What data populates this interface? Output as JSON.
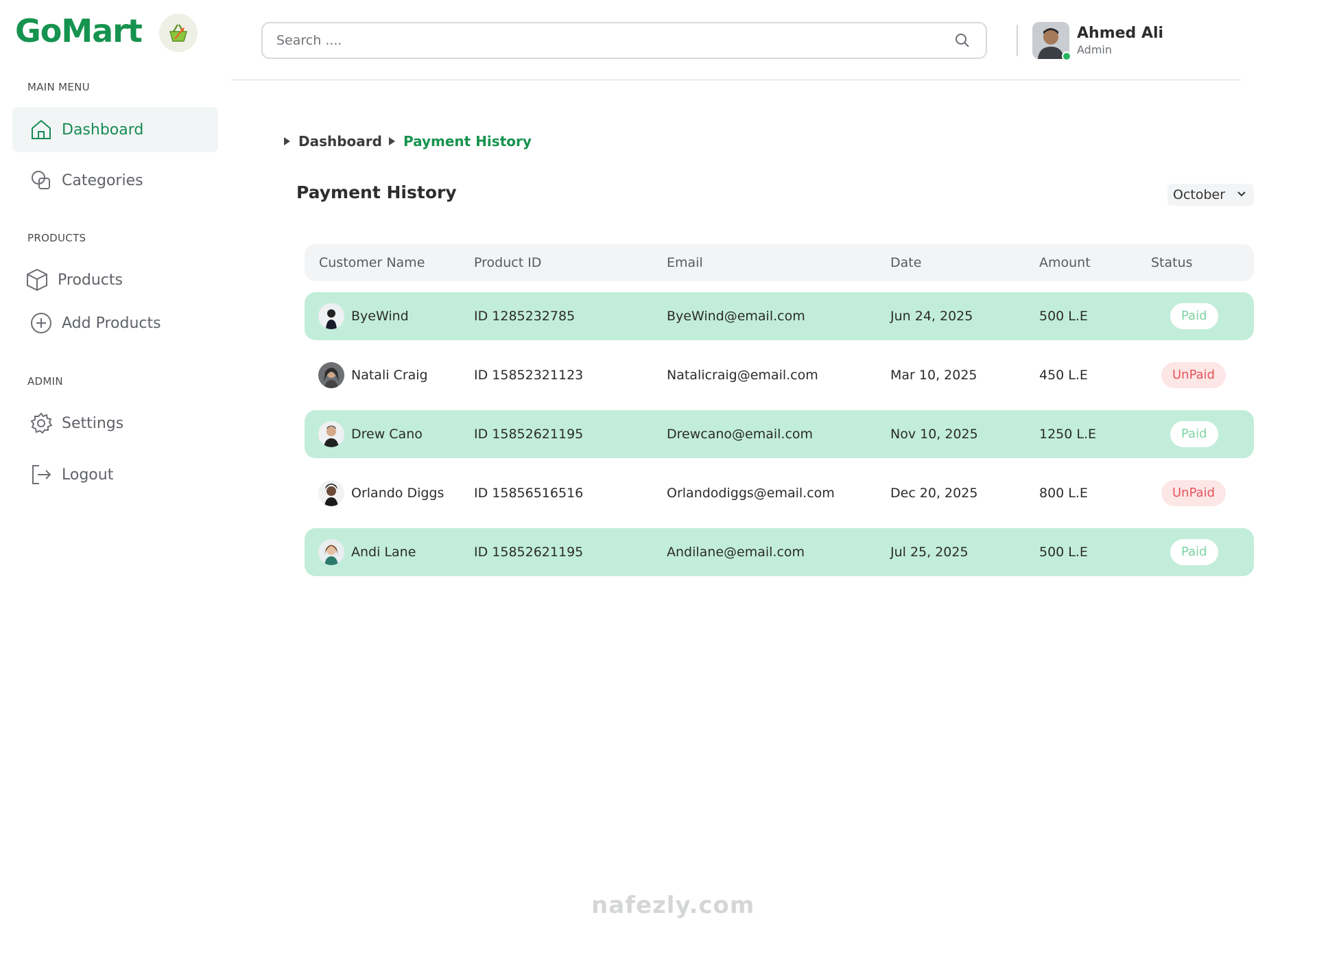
{
  "brand": {
    "name": "GoMart"
  },
  "sidebar": {
    "sections": [
      {
        "label": "MAIN MENU"
      },
      {
        "label": "PRODUCTS"
      },
      {
        "label": "ADMIN"
      }
    ],
    "items": [
      {
        "label": "Dashboard",
        "icon": "home-icon",
        "active": true
      },
      {
        "label": "Categories",
        "icon": "categories-icon"
      },
      {
        "label": "Products",
        "icon": "box-icon"
      },
      {
        "label": "Add Products",
        "icon": "plus-circle-icon"
      },
      {
        "label": "Settings",
        "icon": "gear-icon"
      },
      {
        "label": "Logout",
        "icon": "logout-icon"
      }
    ]
  },
  "search": {
    "placeholder": "Search ...."
  },
  "user": {
    "name": "Ahmed Ali",
    "role": "Admin"
  },
  "breadcrumb": {
    "items": [
      "Dashboard",
      "Payment History"
    ]
  },
  "page": {
    "title": "Payment History",
    "month": "October"
  },
  "table": {
    "headers": [
      "Customer Name",
      "Product ID",
      "Email",
      "Date",
      "Amount",
      "Status"
    ],
    "rows": [
      {
        "name": "ByeWind",
        "product_id": "ID 1285232785",
        "email": "ByeWind@email.com",
        "date": "Jun 24, 2025",
        "amount": "500 L.E",
        "status": "Paid"
      },
      {
        "name": "Natali Craig",
        "product_id": "ID 15852321123",
        "email": "Natalicraig@email.com",
        "date": "Mar 10, 2025",
        "amount": "450 L.E",
        "status": "UnPaid"
      },
      {
        "name": "Drew Cano",
        "product_id": "ID 15852621195",
        "email": "Drewcano@email.com",
        "date": "Nov 10, 2025",
        "amount": "1250 L.E",
        "status": "Paid"
      },
      {
        "name": "Orlando Diggs",
        "product_id": "ID 15856516516",
        "email": "Orlandodiggs@email.com",
        "date": "Dec 20, 2025",
        "amount": "800 L.E",
        "status": "UnPaid"
      },
      {
        "name": "Andi Lane",
        "product_id": "ID 15852621195",
        "email": "Andilane@email.com",
        "date": "Jul 25, 2025",
        "amount": "500 L.E",
        "status": "Paid"
      }
    ]
  },
  "watermark": {
    "text": "nafezly.com"
  },
  "colors": {
    "brand": "#16934f",
    "row_highlight": "#c2eddb",
    "paid": "#7ed3a3",
    "unpaid": "#e4555c"
  }
}
